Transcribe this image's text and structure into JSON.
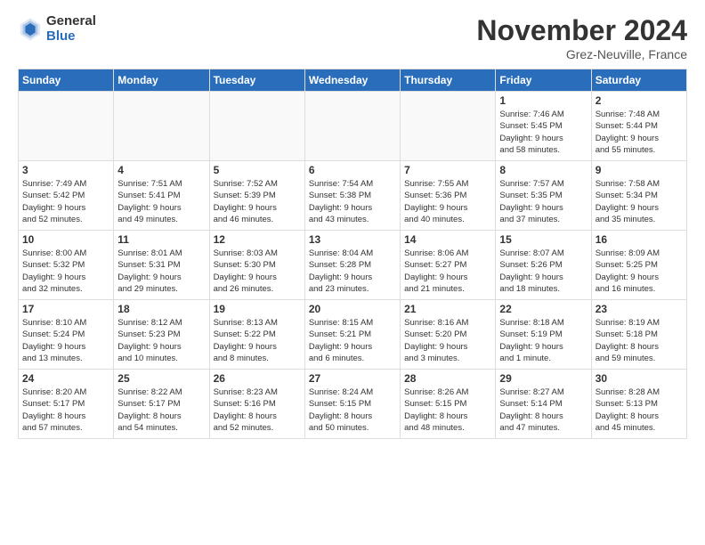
{
  "logo": {
    "general": "General",
    "blue": "Blue"
  },
  "title": "November 2024",
  "location": "Grez-Neuville, France",
  "days_header": [
    "Sunday",
    "Monday",
    "Tuesday",
    "Wednesday",
    "Thursday",
    "Friday",
    "Saturday"
  ],
  "weeks": [
    [
      {
        "day": "",
        "detail": ""
      },
      {
        "day": "",
        "detail": ""
      },
      {
        "day": "",
        "detail": ""
      },
      {
        "day": "",
        "detail": ""
      },
      {
        "day": "",
        "detail": ""
      },
      {
        "day": "1",
        "detail": "Sunrise: 7:46 AM\nSunset: 5:45 PM\nDaylight: 9 hours\nand 58 minutes."
      },
      {
        "day": "2",
        "detail": "Sunrise: 7:48 AM\nSunset: 5:44 PM\nDaylight: 9 hours\nand 55 minutes."
      }
    ],
    [
      {
        "day": "3",
        "detail": "Sunrise: 7:49 AM\nSunset: 5:42 PM\nDaylight: 9 hours\nand 52 minutes."
      },
      {
        "day": "4",
        "detail": "Sunrise: 7:51 AM\nSunset: 5:41 PM\nDaylight: 9 hours\nand 49 minutes."
      },
      {
        "day": "5",
        "detail": "Sunrise: 7:52 AM\nSunset: 5:39 PM\nDaylight: 9 hours\nand 46 minutes."
      },
      {
        "day": "6",
        "detail": "Sunrise: 7:54 AM\nSunset: 5:38 PM\nDaylight: 9 hours\nand 43 minutes."
      },
      {
        "day": "7",
        "detail": "Sunrise: 7:55 AM\nSunset: 5:36 PM\nDaylight: 9 hours\nand 40 minutes."
      },
      {
        "day": "8",
        "detail": "Sunrise: 7:57 AM\nSunset: 5:35 PM\nDaylight: 9 hours\nand 37 minutes."
      },
      {
        "day": "9",
        "detail": "Sunrise: 7:58 AM\nSunset: 5:34 PM\nDaylight: 9 hours\nand 35 minutes."
      }
    ],
    [
      {
        "day": "10",
        "detail": "Sunrise: 8:00 AM\nSunset: 5:32 PM\nDaylight: 9 hours\nand 32 minutes."
      },
      {
        "day": "11",
        "detail": "Sunrise: 8:01 AM\nSunset: 5:31 PM\nDaylight: 9 hours\nand 29 minutes."
      },
      {
        "day": "12",
        "detail": "Sunrise: 8:03 AM\nSunset: 5:30 PM\nDaylight: 9 hours\nand 26 minutes."
      },
      {
        "day": "13",
        "detail": "Sunrise: 8:04 AM\nSunset: 5:28 PM\nDaylight: 9 hours\nand 23 minutes."
      },
      {
        "day": "14",
        "detail": "Sunrise: 8:06 AM\nSunset: 5:27 PM\nDaylight: 9 hours\nand 21 minutes."
      },
      {
        "day": "15",
        "detail": "Sunrise: 8:07 AM\nSunset: 5:26 PM\nDaylight: 9 hours\nand 18 minutes."
      },
      {
        "day": "16",
        "detail": "Sunrise: 8:09 AM\nSunset: 5:25 PM\nDaylight: 9 hours\nand 16 minutes."
      }
    ],
    [
      {
        "day": "17",
        "detail": "Sunrise: 8:10 AM\nSunset: 5:24 PM\nDaylight: 9 hours\nand 13 minutes."
      },
      {
        "day": "18",
        "detail": "Sunrise: 8:12 AM\nSunset: 5:23 PM\nDaylight: 9 hours\nand 10 minutes."
      },
      {
        "day": "19",
        "detail": "Sunrise: 8:13 AM\nSunset: 5:22 PM\nDaylight: 9 hours\nand 8 minutes."
      },
      {
        "day": "20",
        "detail": "Sunrise: 8:15 AM\nSunset: 5:21 PM\nDaylight: 9 hours\nand 6 minutes."
      },
      {
        "day": "21",
        "detail": "Sunrise: 8:16 AM\nSunset: 5:20 PM\nDaylight: 9 hours\nand 3 minutes."
      },
      {
        "day": "22",
        "detail": "Sunrise: 8:18 AM\nSunset: 5:19 PM\nDaylight: 9 hours\nand 1 minute."
      },
      {
        "day": "23",
        "detail": "Sunrise: 8:19 AM\nSunset: 5:18 PM\nDaylight: 8 hours\nand 59 minutes."
      }
    ],
    [
      {
        "day": "24",
        "detail": "Sunrise: 8:20 AM\nSunset: 5:17 PM\nDaylight: 8 hours\nand 57 minutes."
      },
      {
        "day": "25",
        "detail": "Sunrise: 8:22 AM\nSunset: 5:17 PM\nDaylight: 8 hours\nand 54 minutes."
      },
      {
        "day": "26",
        "detail": "Sunrise: 8:23 AM\nSunset: 5:16 PM\nDaylight: 8 hours\nand 52 minutes."
      },
      {
        "day": "27",
        "detail": "Sunrise: 8:24 AM\nSunset: 5:15 PM\nDaylight: 8 hours\nand 50 minutes."
      },
      {
        "day": "28",
        "detail": "Sunrise: 8:26 AM\nSunset: 5:15 PM\nDaylight: 8 hours\nand 48 minutes."
      },
      {
        "day": "29",
        "detail": "Sunrise: 8:27 AM\nSunset: 5:14 PM\nDaylight: 8 hours\nand 47 minutes."
      },
      {
        "day": "30",
        "detail": "Sunrise: 8:28 AM\nSunset: 5:13 PM\nDaylight: 8 hours\nand 45 minutes."
      }
    ]
  ]
}
